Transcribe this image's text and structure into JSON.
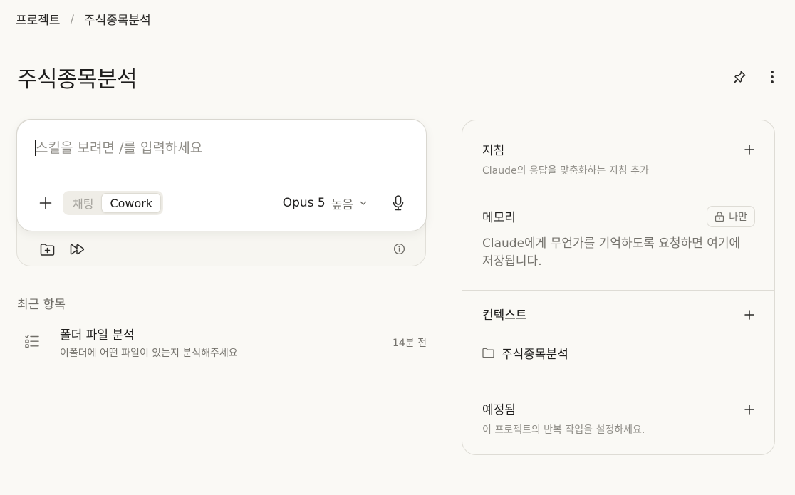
{
  "breadcrumb": {
    "parent": "프로젝트",
    "separator": "/",
    "current": "주식종목분석"
  },
  "title": "주식종목분석",
  "composer": {
    "placeholder": "스킬을 보려면 /를 입력하세요",
    "modes": [
      "채팅",
      "Cowork"
    ],
    "active_mode": "Cowork",
    "model": "Opus 5",
    "effort": "높음"
  },
  "recent": {
    "label": "최근 항목",
    "items": [
      {
        "title": "폴더 파일 분석",
        "subtitle": "이폴더에 어떤 파일이 있는지 분석해주세요",
        "time": "14분 전"
      }
    ]
  },
  "panel": {
    "instructions": {
      "title": "지침",
      "desc": "Claude의 응답을 맞춤화하는 지침 추가"
    },
    "memory": {
      "title": "메모리",
      "badge": "나만",
      "text": "Claude에게 무언가를 기억하도록 요청하면 여기에 저장됩니다."
    },
    "context": {
      "title": "컨텍스트",
      "folder": "주식종목분석"
    },
    "scheduled": {
      "title": "예정됨",
      "desc": "이 프로젝트의 반복 작업을 설정하세요."
    }
  },
  "icons": {
    "pin": "pin-icon",
    "more": "more-vertical-icon",
    "plus": "plus-icon",
    "mic": "microphone-icon",
    "folder_add": "folder-plus-icon",
    "skip": "fast-forward-icon",
    "info": "info-icon",
    "task_list": "checklist-icon",
    "lock": "lock-icon",
    "folder": "folder-icon",
    "chevron": "chevron-down-icon"
  },
  "colors": {
    "background": "#faf9f5",
    "border": "#dedcd5",
    "text": "#1f1e1d",
    "muted": "#8f8d87"
  }
}
